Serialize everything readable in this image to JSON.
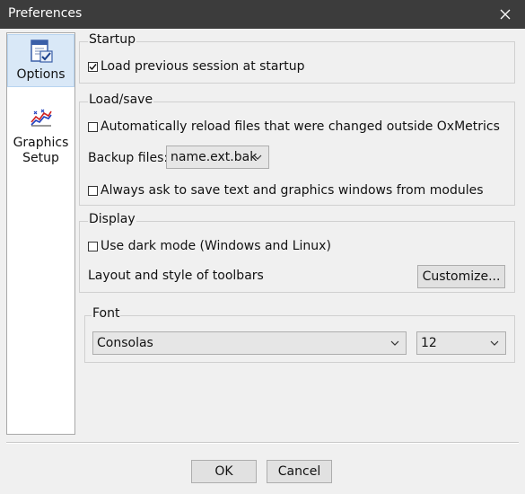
{
  "window": {
    "title": "Preferences",
    "close_icon": "close-icon"
  },
  "sidebar": {
    "items": [
      {
        "label": "Options",
        "icon": "options-document-icon",
        "selected": true
      },
      {
        "label": "Graphics Setup",
        "label_line1": "Graphics",
        "label_line2": "Setup",
        "icon": "graphics-chart-icon",
        "selected": false
      }
    ]
  },
  "startup": {
    "title": "Startup",
    "load_previous": {
      "label": "Load previous session at startup",
      "checked": true
    }
  },
  "loadsave": {
    "title": "Load/save",
    "auto_reload": {
      "label": "Automatically reload files that were changed outside OxMetrics",
      "checked": false
    },
    "backup_label": "Backup files:",
    "backup_value": "name.ext.bak",
    "always_ask": {
      "label": "Always ask to save text and graphics windows from modules",
      "checked": false
    }
  },
  "display": {
    "title": "Display",
    "dark_mode": {
      "label": "Use dark mode (Windows and Linux)",
      "checked": false
    },
    "toolbars_label": "Layout and style of toolbars",
    "customize_button": "Customize..."
  },
  "font": {
    "title": "Font",
    "family": "Consolas",
    "size": "12"
  },
  "footer": {
    "ok": "OK",
    "cancel": "Cancel"
  }
}
